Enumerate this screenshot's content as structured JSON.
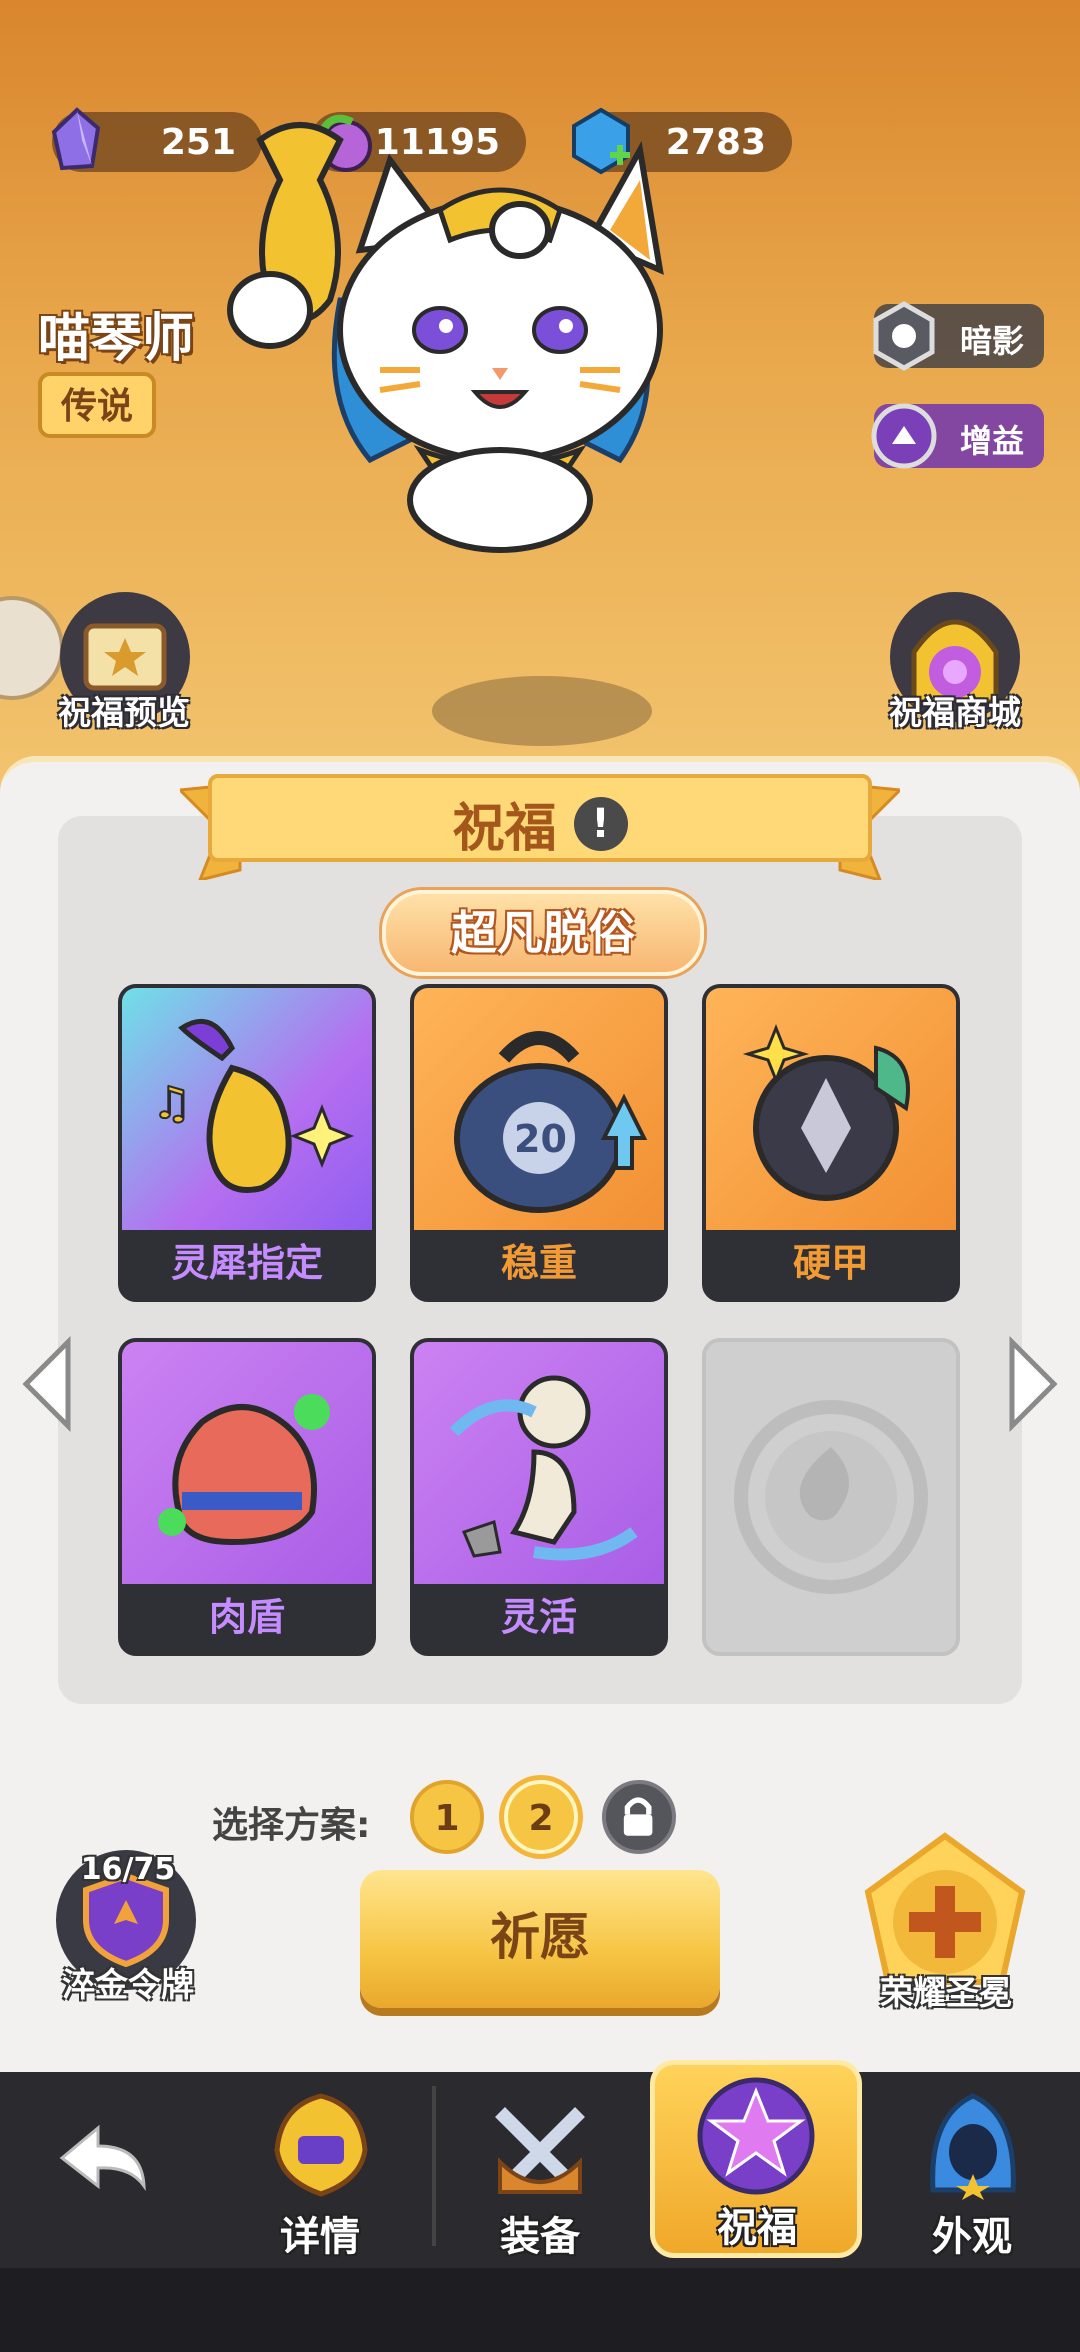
{
  "currencies": [
    {
      "icon": "crystal-icon",
      "value": "251"
    },
    {
      "icon": "potion-icon",
      "value": "11195"
    },
    {
      "icon": "gem-plus-icon",
      "value": "2783"
    }
  ],
  "hero": {
    "name": "喵琴师",
    "rarity": "传说"
  },
  "tags": [
    {
      "icon": "shadow-icon",
      "label": "暗影"
    },
    {
      "icon": "buff-icon",
      "label": "增益"
    }
  ],
  "side": {
    "preview_label": "祝福预览",
    "shop_label": "祝福商城",
    "medal_progress": "16/75",
    "medal_label": "淬金令牌",
    "crown_label": "荣耀圣冕"
  },
  "panel": {
    "title": "祝福",
    "tier": "超凡脱俗",
    "cards": [
      {
        "name": "灵犀指定",
        "theme": "rainbow",
        "icon": "golden-lute-icon"
      },
      {
        "name": "稳重",
        "theme": "orange",
        "icon": "weight-20-icon"
      },
      {
        "name": "硬甲",
        "theme": "orange",
        "icon": "armor-icon"
      },
      {
        "name": "肉盾",
        "theme": "purple",
        "icon": "flexed-arm-icon"
      },
      {
        "name": "灵活",
        "theme": "purple",
        "icon": "dodge-icon"
      },
      {
        "name": "",
        "theme": "empty",
        "icon": "empty-slot-icon"
      }
    ],
    "plan_label": "选择方案:",
    "plans": [
      "1",
      "2"
    ],
    "pray_label": "祈愿"
  },
  "nav": {
    "back_icon": "back-arrow-icon",
    "items": [
      {
        "label": "详情",
        "icon": "helmet-icon"
      },
      {
        "label": "装备",
        "icon": "swords-icon"
      },
      {
        "label": "祝福",
        "icon": "star-orb-icon"
      },
      {
        "label": "外观",
        "icon": "hood-icon"
      }
    ]
  },
  "colors": {
    "accent": "#f7c544",
    "panel_bg": "#f2f1ef",
    "nav_bg": "#2a2a2f",
    "title_text": "#a3571a"
  }
}
